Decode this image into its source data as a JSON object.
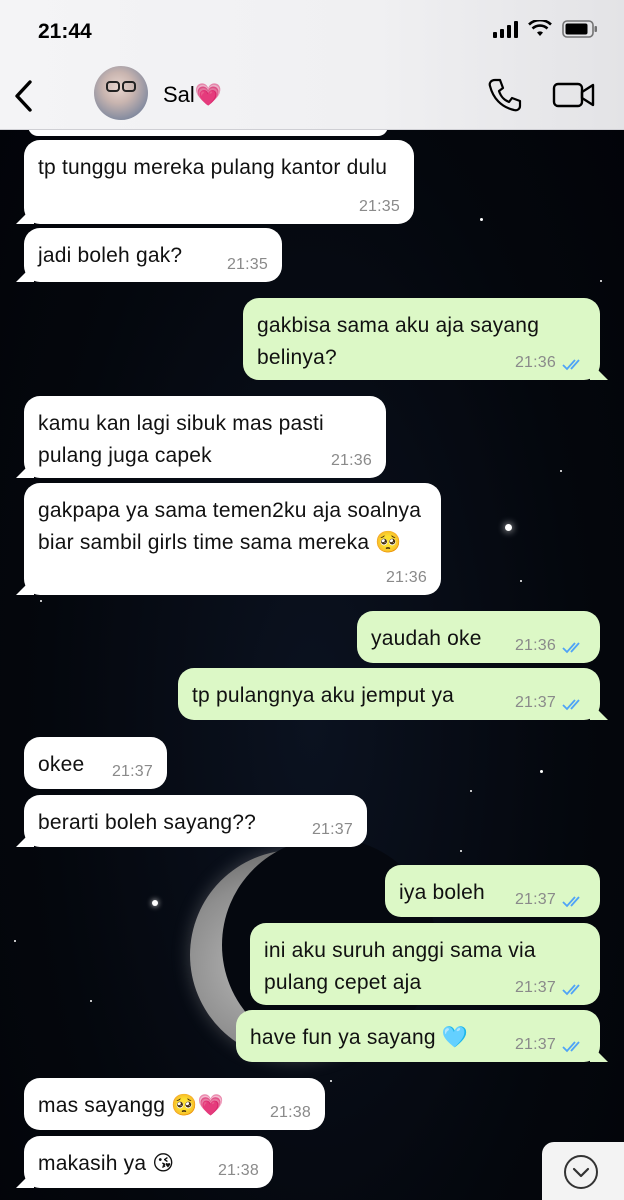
{
  "status_bar": {
    "time": "21:44"
  },
  "header": {
    "contact_name": "Sal💗"
  },
  "messages": [
    {
      "dir": "in",
      "text": "tp tunggu mereka pulang kantor dulu",
      "time": "21:35"
    },
    {
      "dir": "in",
      "text": "jadi boleh gak?",
      "time": "21:35"
    },
    {
      "dir": "out",
      "text": "gakbisa sama aku aja sayang belinya?",
      "time": "21:36",
      "status": "read"
    },
    {
      "dir": "in",
      "text": "kamu kan lagi sibuk mas pasti pulang juga capek",
      "time": "21:36"
    },
    {
      "dir": "in",
      "text": "gakpapa ya sama temen2ku aja soalnya biar sambil girls time sama mereka 🥺",
      "time": "21:36"
    },
    {
      "dir": "out",
      "text": "yaudah oke",
      "time": "21:36",
      "status": "read"
    },
    {
      "dir": "out",
      "text": "tp pulangnya aku jemput ya",
      "time": "21:37",
      "status": "read"
    },
    {
      "dir": "in",
      "text": "okee",
      "time": "21:37"
    },
    {
      "dir": "in",
      "text": "berarti boleh sayang??",
      "time": "21:37"
    },
    {
      "dir": "out",
      "text": "iya boleh",
      "time": "21:37",
      "status": "read"
    },
    {
      "dir": "out",
      "text": "ini aku suruh anggi sama via pulang cepet aja",
      "time": "21:37",
      "status": "read"
    },
    {
      "dir": "out",
      "text": "have fun ya sayang 🩵",
      "time": "21:37",
      "status": "read"
    },
    {
      "dir": "in",
      "text": "mas sayangg 🥺💗",
      "time": "21:38"
    },
    {
      "dir": "in",
      "text": "makasih ya 😘",
      "time": "21:38"
    }
  ],
  "colors": {
    "incoming_bubble": "#ffffff",
    "outgoing_bubble": "#dcf8c6",
    "read_ticks": "#4fa3f7"
  },
  "icons": [
    "back-icon",
    "phone-icon",
    "video-call-icon",
    "read-receipt-icon",
    "scroll-down-icon"
  ]
}
